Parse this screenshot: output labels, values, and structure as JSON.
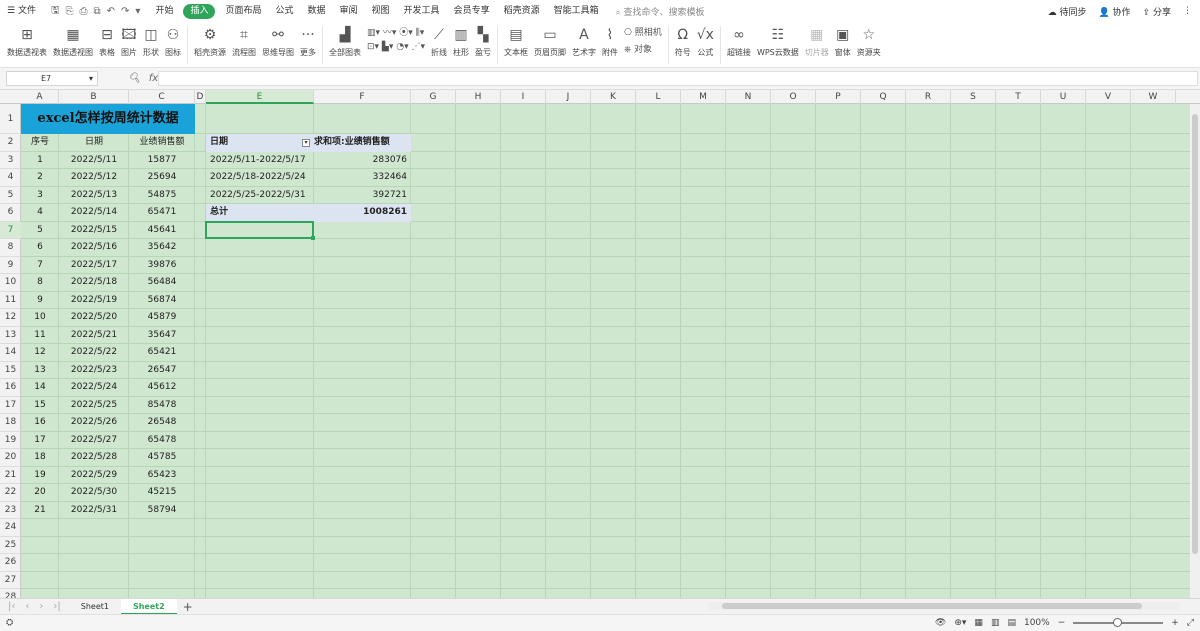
{
  "menu": {
    "file": "文件",
    "tabs": [
      "开始",
      "插入",
      "页面布局",
      "公式",
      "数据",
      "审阅",
      "视图",
      "开发工具",
      "会员专享",
      "稻壳资源",
      "智能工具箱"
    ],
    "active_tab": "插入",
    "search_placeholder": "查找命令、搜索模板",
    "sync": "待同步",
    "collab": "协作",
    "share": "分享"
  },
  "ribbon": {
    "items": [
      "数据透视表",
      "数据透视图",
      "表格",
      "图片",
      "形状",
      "图标",
      "稻壳资源",
      "流程图",
      "思维导图",
      "更多",
      "全部图表",
      "折线",
      "柱形",
      "盈亏",
      "文本框",
      "页眉页脚",
      "艺术字",
      "附件",
      "照相机",
      "对象",
      "符号",
      "公式",
      "超链接",
      "WPS云数据",
      "切片器",
      "窗体",
      "资源夹"
    ]
  },
  "formula_bar": {
    "name_box": "E7",
    "fx": "fx",
    "content": ""
  },
  "columns": [
    "A",
    "B",
    "C",
    "D",
    "E",
    "F",
    "G",
    "H",
    "I",
    "J",
    "K",
    "L",
    "M",
    "N",
    "O",
    "P",
    "Q",
    "R",
    "S",
    "T",
    "U",
    "V",
    "W"
  ],
  "selected_column": "E",
  "rows": [
    "1",
    "2",
    "3",
    "4",
    "5",
    "6",
    "7",
    "8",
    "9",
    "10",
    "11",
    "12",
    "13",
    "14",
    "15",
    "16",
    "17",
    "18",
    "19",
    "20",
    "21",
    "22",
    "23",
    "24",
    "25",
    "26",
    "27",
    "28"
  ],
  "selected_row": "7",
  "sheet": {
    "title": "excel怎样按周统计数据",
    "headers": [
      "序号",
      "日期",
      "业绩销售额"
    ],
    "records": [
      [
        "1",
        "2022/5/11",
        "15877"
      ],
      [
        "2",
        "2022/5/12",
        "25694"
      ],
      [
        "3",
        "2022/5/13",
        "54875"
      ],
      [
        "4",
        "2022/5/14",
        "65471"
      ],
      [
        "5",
        "2022/5/15",
        "45641"
      ],
      [
        "6",
        "2022/5/16",
        "35642"
      ],
      [
        "7",
        "2022/5/17",
        "39876"
      ],
      [
        "8",
        "2022/5/18",
        "56484"
      ],
      [
        "9",
        "2022/5/19",
        "56874"
      ],
      [
        "10",
        "2022/5/20",
        "45879"
      ],
      [
        "11",
        "2022/5/21",
        "35647"
      ],
      [
        "12",
        "2022/5/22",
        "65421"
      ],
      [
        "13",
        "2022/5/23",
        "26547"
      ],
      [
        "14",
        "2022/5/24",
        "45612"
      ],
      [
        "15",
        "2022/5/25",
        "85478"
      ],
      [
        "16",
        "2022/5/26",
        "26548"
      ],
      [
        "17",
        "2022/5/27",
        "65478"
      ],
      [
        "18",
        "2022/5/28",
        "45785"
      ],
      [
        "19",
        "2022/5/29",
        "65423"
      ],
      [
        "20",
        "2022/5/30",
        "45215"
      ],
      [
        "21",
        "2022/5/31",
        "58794"
      ]
    ]
  },
  "pivot": {
    "col_date": "日期",
    "col_sum": "求和项:业绩销售额",
    "rows": [
      [
        "2022/5/11-2022/5/17",
        "283076"
      ],
      [
        "2022/5/18-2022/5/24",
        "332464"
      ],
      [
        "2022/5/25-2022/5/31",
        "392721"
      ]
    ],
    "total_label": "总计",
    "total_value": "1008261"
  },
  "tabs": {
    "sheets": [
      "Sheet1",
      "Sheet2"
    ],
    "active": "Sheet2"
  },
  "status": {
    "zoom": "100%"
  }
}
